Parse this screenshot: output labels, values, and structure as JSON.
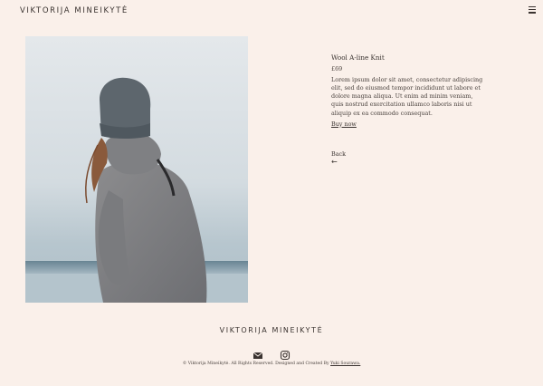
{
  "header": {
    "brand": "VIKTORIJA MINEIKYTĖ",
    "menu_icon": "hamburger-menu-icon"
  },
  "product": {
    "title": "Wool A-line Knit",
    "price": "£69",
    "description": "Lorem ipsum dolor sit amet, consectetur adipiscing elit, sed do eiusmod tempor incididunt ut labore et dolore magna aliqua. Ut enim ad minim veniam, quis nostrud exercitation ullamco laboris nisi ut aliquip ex ea commodo consequat.",
    "buy_label": "Buy now",
    "image_icon": "product-photo"
  },
  "nav": {
    "back_label": "Back",
    "back_icon": "arrow-left-icon"
  },
  "footer": {
    "brand": "VIKTORIJA MINEIKYTĖ",
    "social": [
      {
        "icon": "envelope-icon"
      },
      {
        "icon": "instagram-icon"
      }
    ],
    "copyright_text": "© Viktorija Mineikytė. All Rights Reserved. Designed and Created By ",
    "credit_name": "Yuki Sourawa."
  },
  "colors": {
    "background": "#faf0ea",
    "text": "#3a3330"
  }
}
